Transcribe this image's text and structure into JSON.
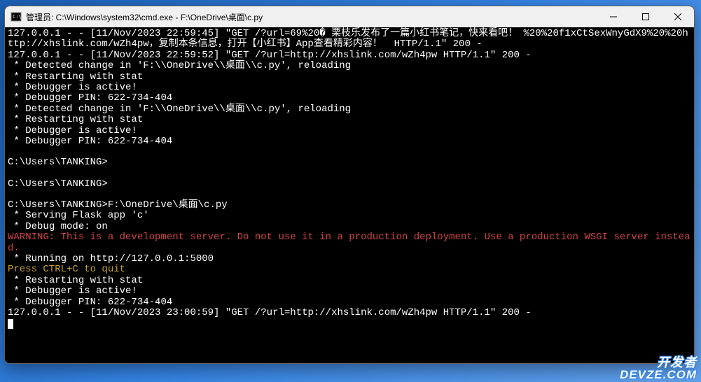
{
  "titlebar": {
    "title": "管理员: C:\\Windows\\system32\\cmd.exe - F:\\OneDrive\\桌面\\c.py"
  },
  "terminal": {
    "lines": [
      {
        "text": "127.0.0.1 - - [11/Nov/2023 22:59:45] \"GET /?url=69%20� 栗枝乐发布了一篇小红书笔记，快来看吧！ %20%20f1xCtSexWnyGdX9%20%20http://xhslink.com/wZh4pw，复制本条信息，打开【小红书】App查看精彩内容！  HTTP/1.1\" 200 -",
        "class": ""
      },
      {
        "text": "127.0.0.1 - - [11/Nov/2023 22:59:52] \"GET /?url=http://xhslink.com/wZh4pw HTTP/1.1\" 200 -",
        "class": ""
      },
      {
        "text": " * Detected change in 'F:\\\\OneDrive\\\\桌面\\\\c.py', reloading",
        "class": ""
      },
      {
        "text": " * Restarting with stat",
        "class": ""
      },
      {
        "text": " * Debugger is active!",
        "class": ""
      },
      {
        "text": " * Debugger PIN: 622-734-404",
        "class": ""
      },
      {
        "text": " * Detected change in 'F:\\\\OneDrive\\\\桌面\\\\c.py', reloading",
        "class": ""
      },
      {
        "text": " * Restarting with stat",
        "class": ""
      },
      {
        "text": " * Debugger is active!",
        "class": ""
      },
      {
        "text": " * Debugger PIN: 622-734-404",
        "class": ""
      },
      {
        "text": "",
        "class": ""
      },
      {
        "text": "C:\\Users\\TANKING>",
        "class": ""
      },
      {
        "text": "",
        "class": ""
      },
      {
        "text": "C:\\Users\\TANKING>",
        "class": ""
      },
      {
        "text": "",
        "class": ""
      },
      {
        "text": "C:\\Users\\TANKING>F:\\OneDrive\\桌面\\c.py",
        "class": ""
      },
      {
        "text": " * Serving Flask app 'c'",
        "class": ""
      },
      {
        "text": " * Debug mode: on",
        "class": ""
      },
      {
        "text": "WARNING: This is a development server. Do not use it in a production deployment. Use a production WSGI server instead.",
        "class": "red"
      },
      {
        "text": " * Running on http://127.0.0.1:5000",
        "class": ""
      },
      {
        "text": "Press CTRL+C to quit",
        "class": "yellow"
      },
      {
        "text": " * Restarting with stat",
        "class": ""
      },
      {
        "text": " * Debugger is active!",
        "class": ""
      },
      {
        "text": " * Debugger PIN: 622-734-404",
        "class": ""
      },
      {
        "text": "127.0.0.1 - - [11/Nov/2023 23:00:59] \"GET /?url=http://xhslink.com/wZh4pw HTTP/1.1\" 200 -",
        "class": ""
      }
    ]
  },
  "watermark": {
    "line1": "开发者",
    "line2": "DEVZE.COM"
  }
}
